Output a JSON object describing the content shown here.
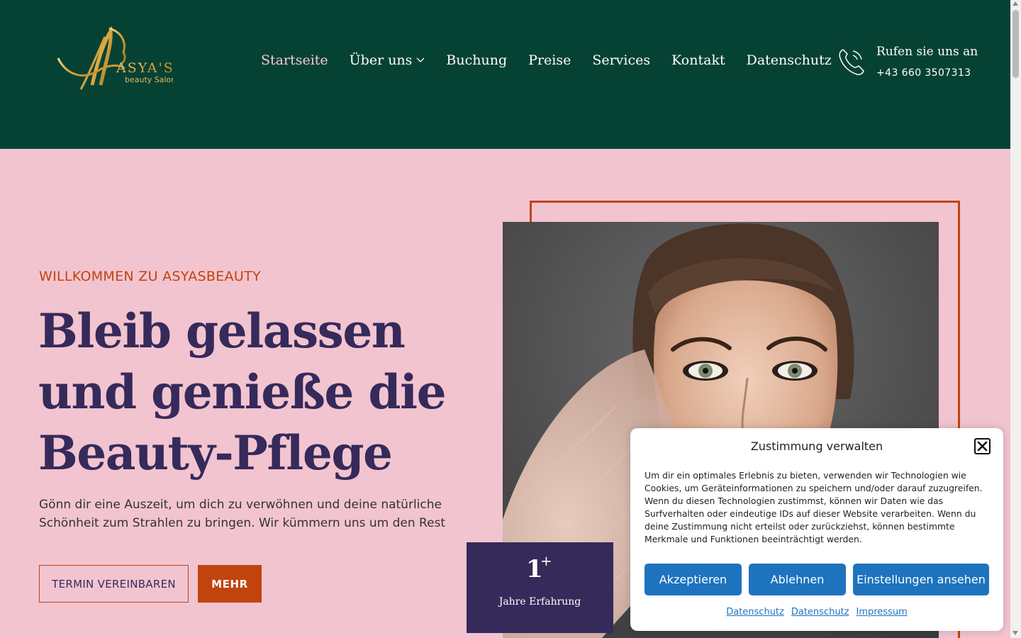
{
  "brand": {
    "logo_main": "ASYA'S",
    "logo_sub": "beauty Salon"
  },
  "nav": {
    "items": [
      {
        "label": "Startseite",
        "active": true
      },
      {
        "label": "Über uns",
        "has_dropdown": true
      },
      {
        "label": "Buchung"
      },
      {
        "label": "Preise"
      },
      {
        "label": "Services"
      },
      {
        "label": "Kontakt"
      },
      {
        "label": "Datenschutz"
      }
    ]
  },
  "contact": {
    "call_label": "Rufen sie uns an",
    "phone": "+43 660 3507313",
    "icon": "phone-icon"
  },
  "hero": {
    "eyebrow": "WILLKOMMEN ZU ASYASBEAUTY",
    "title_lines": [
      "Bleib gelassen",
      "und genieße die",
      "Beauty-Pflege"
    ],
    "description": "Gönn dir eine Auszeit, um dich zu verwöhnen und deine natürliche Schönheit zum Strahlen zu bringen. Wir kümmern uns um den Rest",
    "primary_button": "TERMIN VEREINBAREN",
    "secondary_button": "MEHR"
  },
  "experience": {
    "number": "1",
    "suffix": "+",
    "label": "Jahre Erfahrung"
  },
  "cookie": {
    "title": "Zustimmung verwalten",
    "text": "Um dir ein optimales Erlebnis zu bieten, verwenden wir Technologien wie Cookies, um Geräteinformationen zu speichern und/oder darauf zuzugreifen. Wenn du diesen Technologien zustimmst, können wir Daten wie das Surfverhalten oder eindeutige IDs auf dieser Website verarbeiten. Wenn du deine Zustimmung nicht erteilst oder zurückziehst, können bestimmte Merkmale und Funktionen beeinträchtigt werden.",
    "accept": "Akzeptieren",
    "deny": "Ablehnen",
    "settings": "Einstellungen ansehen",
    "links": [
      "Datenschutz",
      "Datenschutz",
      "Impressum"
    ]
  },
  "colors": {
    "header_bg": "#064234",
    "hero_bg": "#f2c4d0",
    "accent": "#c1440e",
    "heading": "#352a5a",
    "button_blue": "#1e73be"
  }
}
